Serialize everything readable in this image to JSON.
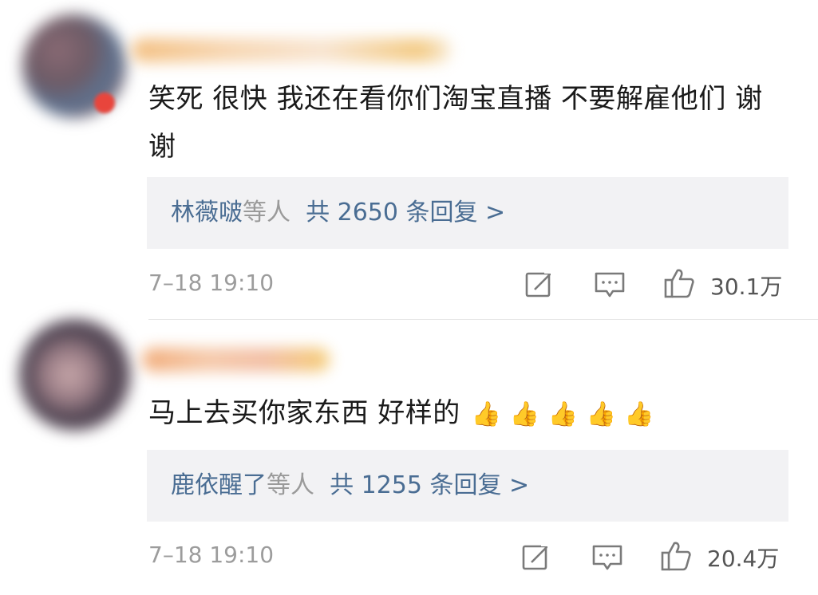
{
  "comments": [
    {
      "text": "笑死 很快 我还在看你们淘宝直播 不要解雇他们 谢谢",
      "reply_names": "林薇啵",
      "reply_mid": "等人",
      "reply_count": "共 2650 条回复 >",
      "time": "7–18 19:10",
      "likes": "30.1万"
    },
    {
      "text": "马上去买你家东西 好样的",
      "emoji": "👍 👍 👍 👍 👍",
      "reply_names": "鹿依醒了",
      "reply_mid": "等人",
      "reply_count": "共 1255 条回复 >",
      "time": "7–18 19:10",
      "likes": "20.4万"
    }
  ],
  "icons": {
    "edit": "edit-icon",
    "comment": "comment-icon",
    "like": "thumbs-up-icon",
    "emoji": "thumbs-up-emoji"
  },
  "colors": {
    "reply_link": "#4a6d93",
    "reply_bg": "#f2f2f4",
    "meta_text": "#9c9c9c",
    "emoji": "#e2a64c"
  }
}
